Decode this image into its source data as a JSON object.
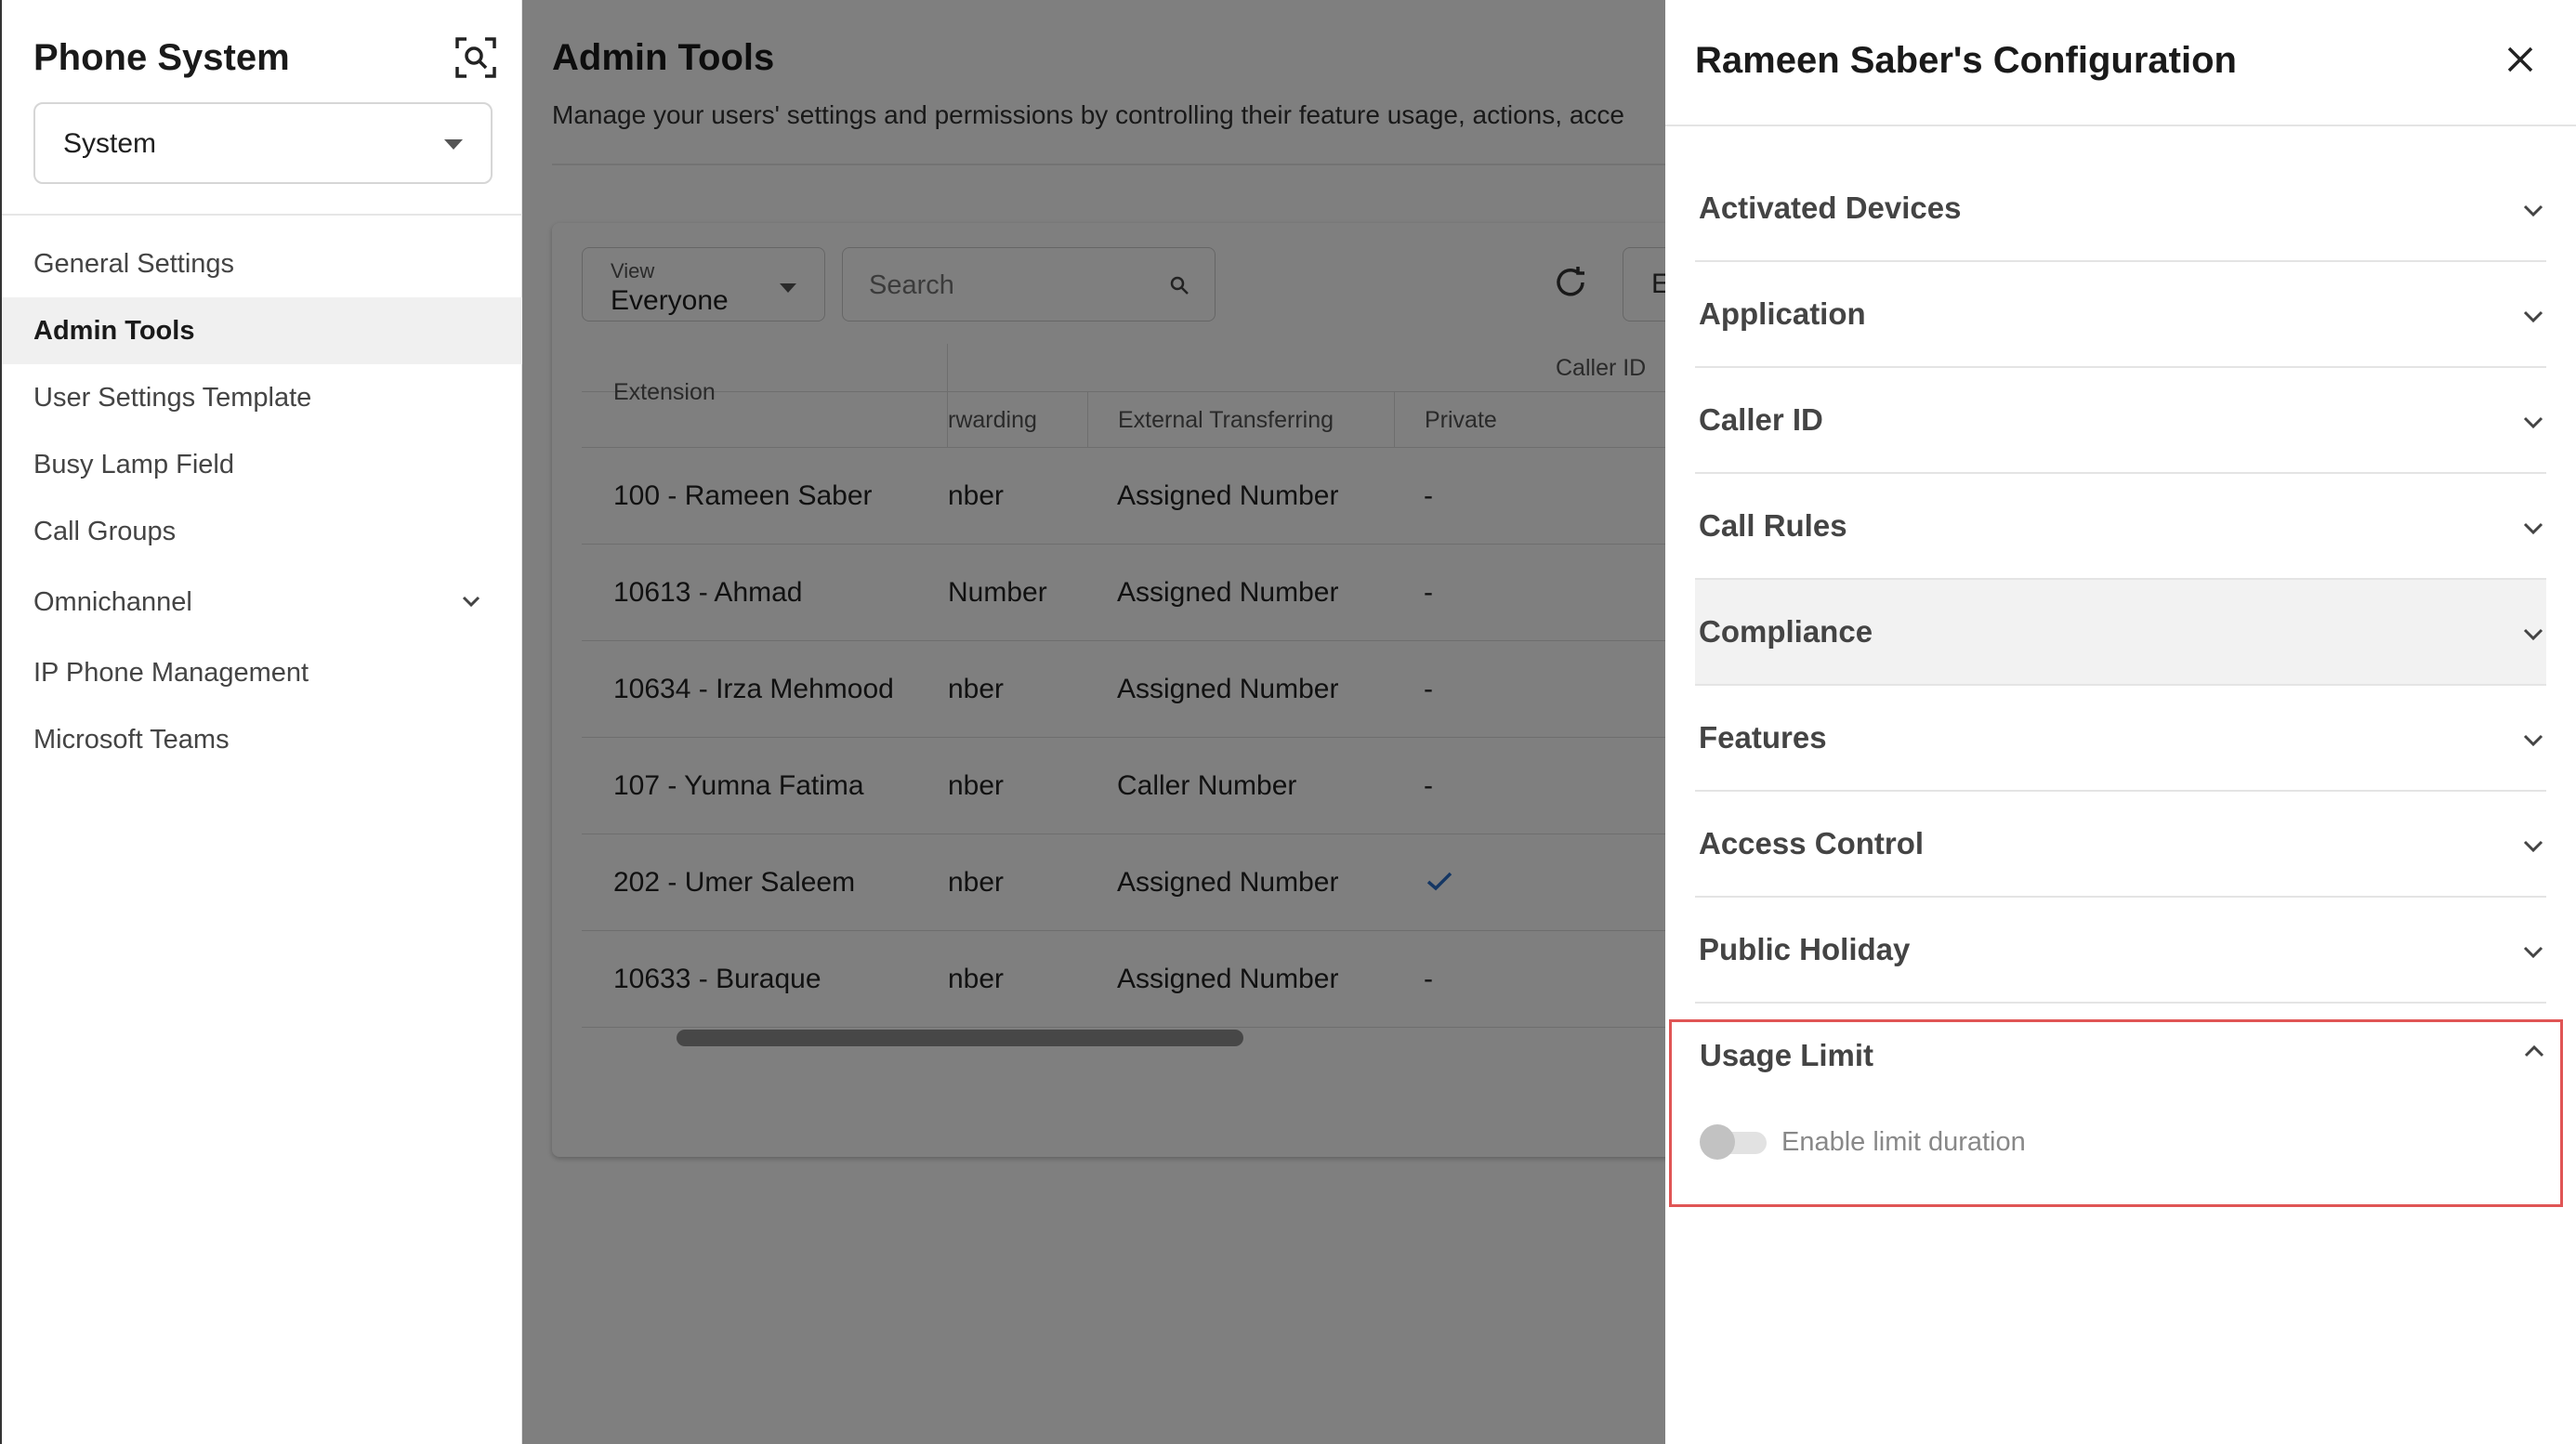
{
  "sidebar": {
    "title": "Phone System",
    "selector": "System",
    "items": [
      {
        "label": "General Settings"
      },
      {
        "label": "Admin Tools"
      },
      {
        "label": "User Settings Template"
      },
      {
        "label": "Busy Lamp Field"
      },
      {
        "label": "Call Groups"
      },
      {
        "label": "Omnichannel"
      },
      {
        "label": "IP Phone Management"
      },
      {
        "label": "Microsoft Teams"
      }
    ]
  },
  "main": {
    "title": "Admin Tools",
    "description": "Manage your users' settings and permissions by controlling their feature usage, actions, acce",
    "view_label": "View",
    "view_value": "Everyone",
    "search_placeholder": "Search",
    "cut_button": "E",
    "group_header": "Caller ID",
    "columns": {
      "extension": "Extension",
      "forwarding": "rwarding",
      "external_transferring": "External Transferring",
      "private": "Private"
    },
    "rows": [
      {
        "extension": "100 - Rameen Saber",
        "forwarding": "nber",
        "external": "Assigned Number",
        "private": "-"
      },
      {
        "extension": "10613 - Ahmad",
        "forwarding": "Number",
        "external": "Assigned Number",
        "private": "-"
      },
      {
        "extension": "10634 - Irza Mehmood",
        "forwarding": "nber",
        "external": "Assigned Number",
        "private": "-"
      },
      {
        "extension": "107 - Yumna Fatima",
        "forwarding": "nber",
        "external": "Caller Number",
        "private": "-"
      },
      {
        "extension": "202 - Umer Saleem",
        "forwarding": "nber",
        "external": "Assigned Number",
        "private": "check"
      },
      {
        "extension": "10633 - Buraque",
        "forwarding": "nber",
        "external": "Assigned Number",
        "private": "-"
      }
    ]
  },
  "panel": {
    "title": "Rameen Saber's Configuration",
    "sections": [
      {
        "label": "Activated Devices"
      },
      {
        "label": "Application"
      },
      {
        "label": "Caller ID"
      },
      {
        "label": "Call Rules"
      },
      {
        "label": "Compliance"
      },
      {
        "label": "Features"
      },
      {
        "label": "Access Control"
      },
      {
        "label": "Public Holiday"
      }
    ],
    "usage_limit": {
      "label": "Usage Limit",
      "toggle_label": "Enable limit duration",
      "toggle_on": false
    }
  },
  "colors": {
    "highlight_border": "#e05555",
    "check": "#2a6fc9"
  },
  "icons": [
    "scan-icon",
    "chevron-down-icon",
    "search-icon",
    "refresh-icon",
    "check-icon",
    "close-icon",
    "chevron-up-icon"
  ]
}
